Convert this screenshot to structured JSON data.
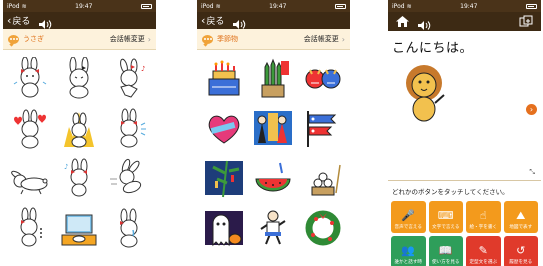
{
  "status": {
    "carrier": "iPod",
    "time": "19:47"
  },
  "nav": {
    "back_label": "戻る"
  },
  "screen1": {
    "category": "うさぎ",
    "change_label": "会話帳変更"
  },
  "screen2": {
    "category": "季節物",
    "change_label": "会話帳変更"
  },
  "screen3": {
    "message": "こんにちは。",
    "instruction": "どれかのボタンをタッチしてください。",
    "buttons": [
      {
        "label": "音声で言える",
        "icon": "microphone-icon",
        "color": "orange"
      },
      {
        "label": "文字で言える",
        "icon": "keyboard-icon",
        "color": "orange"
      },
      {
        "label": "絵・字を書く",
        "icon": "hand-pointer-icon",
        "color": "orange"
      },
      {
        "label": "地図で表す",
        "icon": "map-icon",
        "color": "orange"
      },
      {
        "label": "誰かと話す時",
        "icon": "people-icon",
        "color": "green"
      },
      {
        "label": "使い方を見る",
        "icon": "book-icon",
        "color": "green"
      },
      {
        "label": "定型文を選ぶ",
        "icon": "note-icon",
        "color": "red"
      },
      {
        "label": "履歴を見る",
        "icon": "history-icon",
        "color": "red"
      }
    ]
  },
  "colors": {
    "bar": "#3d2a14",
    "status": "#4a3319",
    "accent": "#e0731b",
    "btn_orange": "#f39a1c",
    "btn_green": "#2e9e5a",
    "btn_red": "#e03a2b"
  }
}
